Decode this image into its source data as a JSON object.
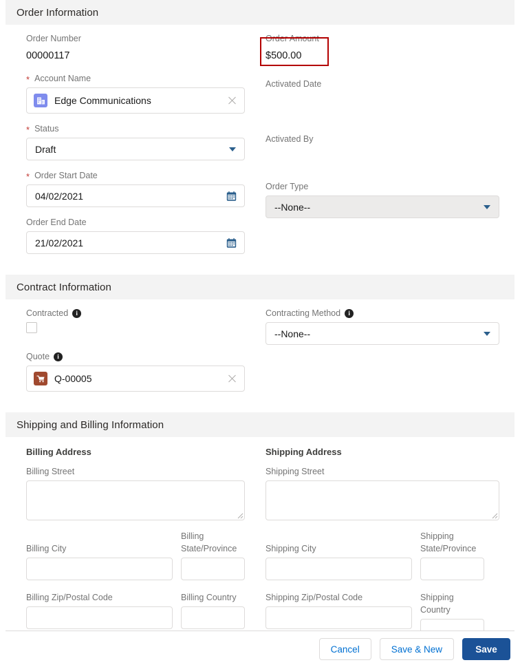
{
  "sections": {
    "order_information": {
      "title": "Order Information",
      "fields": {
        "order_number": {
          "label": "Order Number",
          "value": "00000117"
        },
        "order_amount": {
          "label": "Order Amount",
          "value": "$500.00",
          "highlight_color": "#b30000"
        },
        "account_name": {
          "label": "Account Name",
          "required": true,
          "value": "Edge Communications",
          "icon": "account-icon",
          "icon_color": "#7f8ced"
        },
        "activated_date": {
          "label": "Activated Date",
          "value": ""
        },
        "status": {
          "label": "Status",
          "required": true,
          "value": "Draft"
        },
        "activated_by": {
          "label": "Activated By",
          "value": ""
        },
        "order_start_date": {
          "label": "Order Start Date",
          "required": true,
          "value": "04/02/2021"
        },
        "order_type": {
          "label": "Order Type",
          "value": "--None--"
        },
        "order_end_date": {
          "label": "Order End Date",
          "value": "21/02/2021"
        }
      }
    },
    "contract_information": {
      "title": "Contract Information",
      "fields": {
        "contracted": {
          "label": "Contracted",
          "checked": false,
          "has_info": true
        },
        "contracting_method": {
          "label": "Contracting Method",
          "value": "--None--",
          "has_info": true
        },
        "quote": {
          "label": "Quote",
          "value": "Q-00005",
          "has_info": true,
          "icon": "quote-cart-icon",
          "icon_color": "#a0492f"
        }
      }
    },
    "shipping_and_billing": {
      "title": "Shipping and Billing Information",
      "billing": {
        "heading": "Billing Address",
        "street": {
          "label": "Billing Street",
          "value": ""
        },
        "city": {
          "label": "Billing City",
          "value": ""
        },
        "state": {
          "label": "Billing State/Province",
          "value": ""
        },
        "zip": {
          "label": "Billing Zip/Postal Code",
          "value": ""
        },
        "country": {
          "label": "Billing Country",
          "value": ""
        }
      },
      "shipping": {
        "heading": "Shipping Address",
        "street": {
          "label": "Shipping Street",
          "value": ""
        },
        "city": {
          "label": "Shipping City",
          "value": ""
        },
        "state": {
          "label": "Shipping State/Province",
          "value": ""
        },
        "zip": {
          "label": "Shipping Zip/Postal Code",
          "value": ""
        },
        "country": {
          "label": "Shipping Country",
          "value": ""
        }
      }
    }
  },
  "footer": {
    "cancel_label": "Cancel",
    "save_new_label": "Save & New",
    "save_label": "Save",
    "primary_color": "#1b5297",
    "link_color": "#0070d2"
  }
}
